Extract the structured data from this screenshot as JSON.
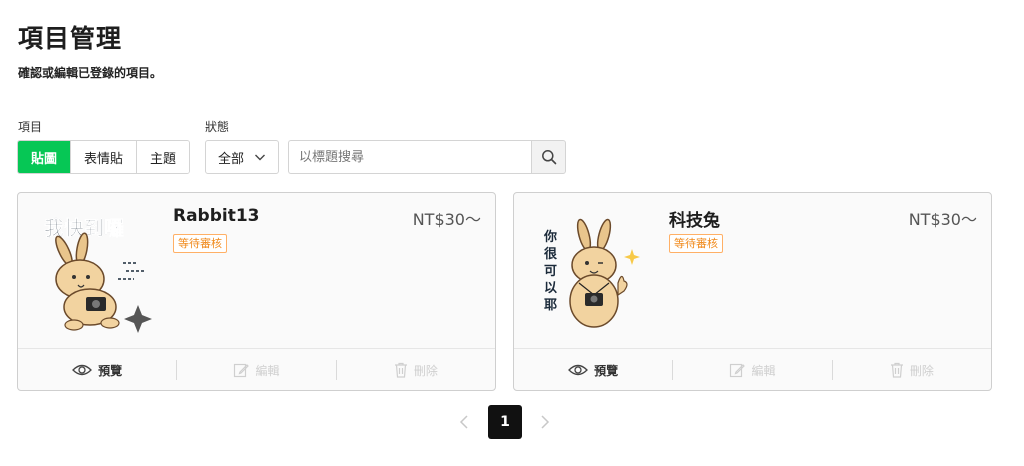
{
  "header": {
    "title": "項目管理",
    "description": "確認或編輯已登錄的項目。"
  },
  "filters": {
    "type_label": "項目",
    "types": [
      {
        "label": "貼圖",
        "active": true
      },
      {
        "label": "表情貼",
        "active": false
      },
      {
        "label": "主題",
        "active": false
      }
    ],
    "status_label": "狀態",
    "status_value": "全部",
    "search_placeholder": "以標題搜尋",
    "search_value": ""
  },
  "items": [
    {
      "name": "Rabbit13",
      "price": "NT$30〜",
      "status": "等待審核",
      "sticker_text": "我快到囉",
      "actions": {
        "preview": "預覽",
        "edit": "編輯",
        "delete": "刪除"
      }
    },
    {
      "name": "科技兔",
      "price": "NT$30〜",
      "status": "等待審核",
      "sticker_text": "你很可以耶",
      "actions": {
        "preview": "預覽",
        "edit": "編輯",
        "delete": "刪除"
      }
    }
  ],
  "pagination": {
    "current": "1"
  },
  "colors": {
    "accent": "#06c755",
    "badge": "#f08a1c",
    "pager_active": "#111111"
  },
  "icons": [
    "search-icon",
    "chevron-down-icon",
    "eye-icon",
    "edit-icon",
    "trash-icon",
    "chevron-left-icon",
    "chevron-right-icon"
  ]
}
